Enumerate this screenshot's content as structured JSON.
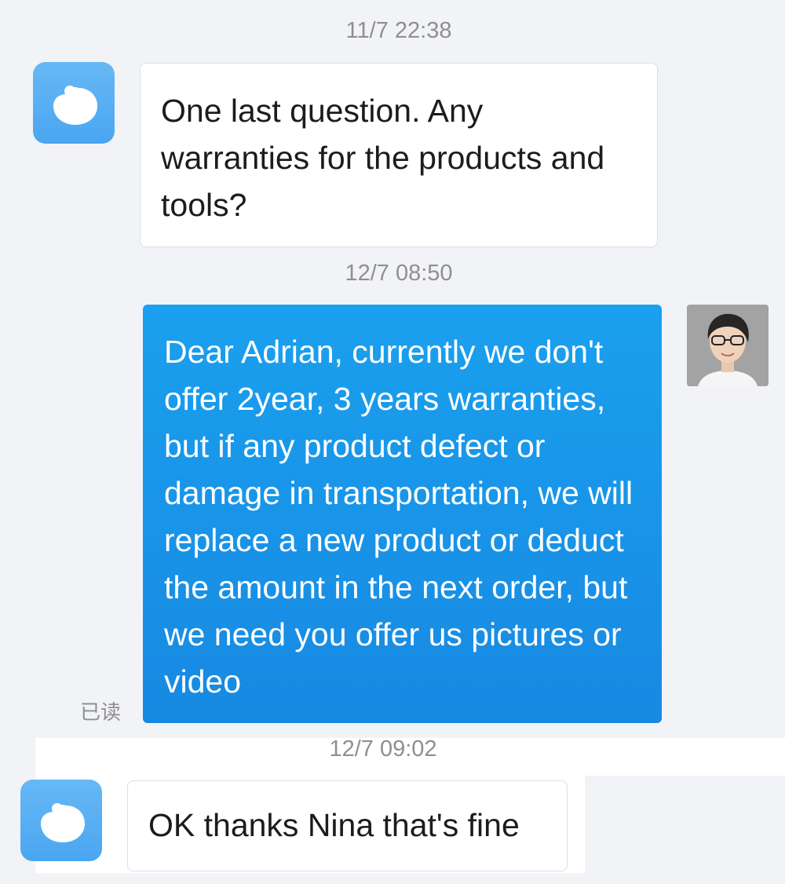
{
  "conversation": {
    "messages": [
      {
        "timestamp": "11/7 22:38",
        "sender": "contact",
        "text": "One last question. Any warranties for the products and tools?"
      },
      {
        "timestamp": "12/7 08:50",
        "sender": "self",
        "text": "Dear Adrian, currently we don't offer 2year, 3 years warranties, but if any product defect or damage in transportation, we will replace a new product or deduct the amount in the next order, but we need you offer us pictures or video",
        "read_status": "已读"
      },
      {
        "timestamp": "12/7 09:02",
        "sender": "contact",
        "text": "OK thanks Nina that's fine"
      }
    ]
  },
  "icons": {
    "contact_avatar": "chat-bubble-app-icon",
    "self_avatar": "user-photo-avatar"
  },
  "colors": {
    "background": "#f2f3f7",
    "outgoing_bubble": "#1a96ea",
    "incoming_bubble": "#ffffff",
    "app_icon": "#5aaff3",
    "timestamp_text": "#8f8f8f"
  }
}
